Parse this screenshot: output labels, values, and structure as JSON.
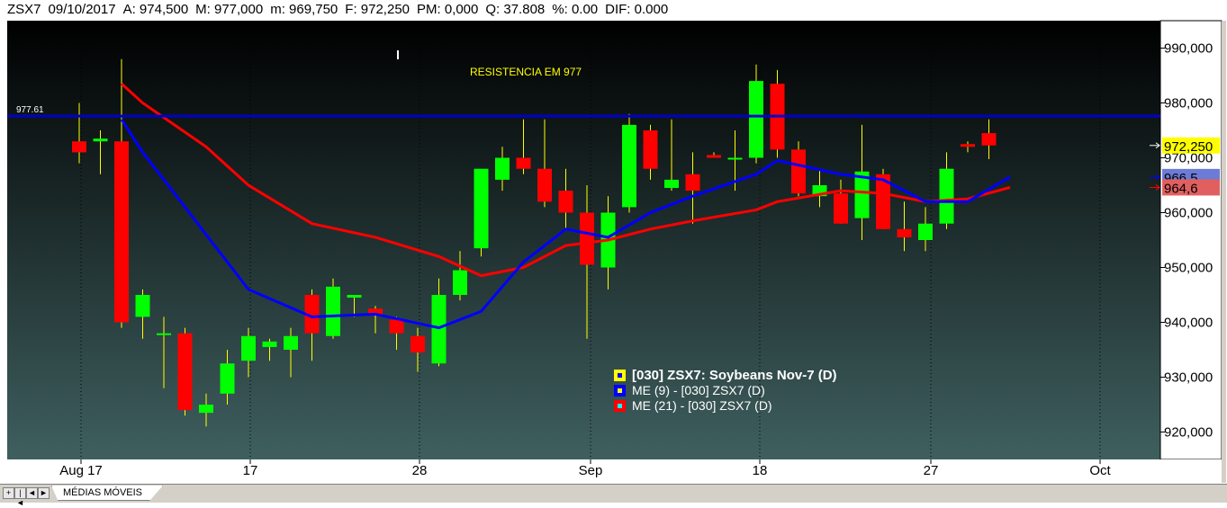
{
  "info_bar": {
    "symbol": "ZSX7",
    "date": "09/10/2017",
    "open": "A: 974,500",
    "max": "M: 977,000",
    "min": "m: 969,750",
    "close": "F: 972,250",
    "pm": "PM: 0,000",
    "qty": "Q: 37.808",
    "pct": "%: 0.00",
    "dif": "DIF: 0.000"
  },
  "bottom_bar": {
    "tab_label": "MÉDIAS MÓVEIS",
    "nav_first": "+",
    "nav_prev": "|◄",
    "nav_back": "◄",
    "nav_next": "►"
  },
  "colors": {
    "background_top": "#000000",
    "background_bottom": "#3f5f5f",
    "up_candle": "#00ff00",
    "down_candle": "#ff0000",
    "wick": "#ffff00",
    "ema9": "#0000ff",
    "ema21": "#ff0000",
    "resistance": "#0000cc",
    "annotation": "#ffff00"
  },
  "chart_data": {
    "type": "candlestick",
    "title": "[030] ZSX7: Soybeans Nov-7",
    "ylim": [
      915000,
      995000
    ],
    "y_ticks": [
      "920,000",
      "930,000",
      "940,000",
      "950,000",
      "960,000",
      "970,000",
      "980,000",
      "990,000"
    ],
    "x_ticks": [
      "Aug 17",
      "17",
      "28",
      "Sep",
      "18",
      "27",
      "Oct"
    ],
    "resistance": {
      "value": 977.61,
      "label": "977.61",
      "text": "RESISTENCIA EM 977"
    },
    "marker_labels": {
      "close": "972,250",
      "ema9": "966,5",
      "ema21": "964,6"
    },
    "legend": [
      {
        "label": "[030] ZSX7: Soybeans Nov-7    (D)",
        "marker": "yellow"
      },
      {
        "label": "ME (9)  - [030] ZSX7 (D)",
        "marker": "blue"
      },
      {
        "label": "ME (21)  - [030] ZSX7 (D)",
        "marker": "red"
      }
    ],
    "candles": [
      [
        973,
        980,
        969,
        971
      ],
      [
        973,
        975,
        967,
        973.5
      ],
      [
        973,
        988,
        939,
        940
      ],
      [
        941,
        946,
        937,
        945
      ],
      [
        938,
        941,
        928,
        938
      ],
      [
        938,
        939,
        923,
        924
      ],
      [
        923.5,
        927,
        921,
        925
      ],
      [
        927,
        935,
        925,
        932.5
      ],
      [
        933,
        939,
        930,
        937.5
      ],
      [
        935.5,
        937,
        933,
        936.5
      ],
      [
        935,
        939,
        930,
        937.5
      ],
      [
        945,
        946,
        933,
        938
      ],
      [
        937.5,
        948,
        937,
        946.5
      ],
      [
        944.5,
        945,
        941,
        945
      ],
      [
        942.5,
        943,
        938,
        941.5
      ],
      [
        940.5,
        941,
        935,
        938
      ],
      [
        937.5,
        939,
        931,
        934.5
      ],
      [
        932.5,
        948,
        932,
        945
      ],
      [
        945,
        953,
        944,
        949.5
      ],
      [
        953.5,
        966,
        952,
        968
      ],
      [
        966,
        972,
        964,
        970
      ],
      [
        970,
        977,
        967,
        968
      ],
      [
        968,
        977,
        961,
        962
      ],
      [
        964,
        968,
        957,
        960
      ],
      [
        960,
        965,
        937,
        950.5
      ],
      [
        950,
        963,
        946,
        960
      ],
      [
        961,
        978,
        960,
        976
      ],
      [
        975,
        976,
        966,
        968
      ],
      [
        964.5,
        977,
        964,
        966
      ],
      [
        967,
        971,
        958,
        964
      ],
      [
        970.5,
        971,
        970,
        970
      ],
      [
        970,
        975,
        964,
        970
      ],
      [
        970,
        987,
        969,
        984
      ],
      [
        983.5,
        986,
        970,
        971.5
      ],
      [
        971.5,
        973,
        963,
        963.5
      ],
      [
        963,
        968,
        961,
        965
      ],
      [
        963.5,
        966,
        958,
        958
      ],
      [
        959,
        976,
        955,
        967.5
      ],
      [
        967,
        968,
        957,
        957
      ],
      [
        957,
        962,
        953,
        955.5
      ],
      [
        955,
        961,
        953,
        958
      ],
      [
        958,
        971,
        957,
        968
      ],
      [
        972.5,
        973,
        971,
        972
      ],
      [
        974.5,
        977,
        969.75,
        972.25
      ]
    ],
    "ema9": [
      [
        2,
        977
      ],
      [
        3,
        971
      ],
      [
        6,
        956
      ],
      [
        8,
        946
      ],
      [
        11,
        941
      ],
      [
        14,
        941.5
      ],
      [
        17,
        939
      ],
      [
        19,
        942
      ],
      [
        21,
        951
      ],
      [
        23,
        957
      ],
      [
        25,
        955.5
      ],
      [
        27,
        960
      ],
      [
        29,
        963
      ],
      [
        32,
        967
      ],
      [
        33,
        969.5
      ],
      [
        36,
        967
      ],
      [
        38,
        966
      ],
      [
        40,
        962
      ],
      [
        42,
        962
      ],
      [
        44,
        966.5
      ]
    ],
    "ema21": [
      [
        2,
        983.5
      ],
      [
        3,
        980
      ],
      [
        6,
        972
      ],
      [
        8,
        965
      ],
      [
        11,
        958
      ],
      [
        14,
        955.5
      ],
      [
        17,
        952
      ],
      [
        19,
        948.5
      ],
      [
        21,
        950
      ],
      [
        23,
        954
      ],
      [
        25,
        955
      ],
      [
        27,
        957
      ],
      [
        29,
        958.5
      ],
      [
        32,
        960.5
      ],
      [
        33,
        962
      ],
      [
        36,
        964
      ],
      [
        38,
        963.5
      ],
      [
        40,
        962
      ],
      [
        42,
        962.5
      ],
      [
        44,
        964.6
      ]
    ]
  }
}
